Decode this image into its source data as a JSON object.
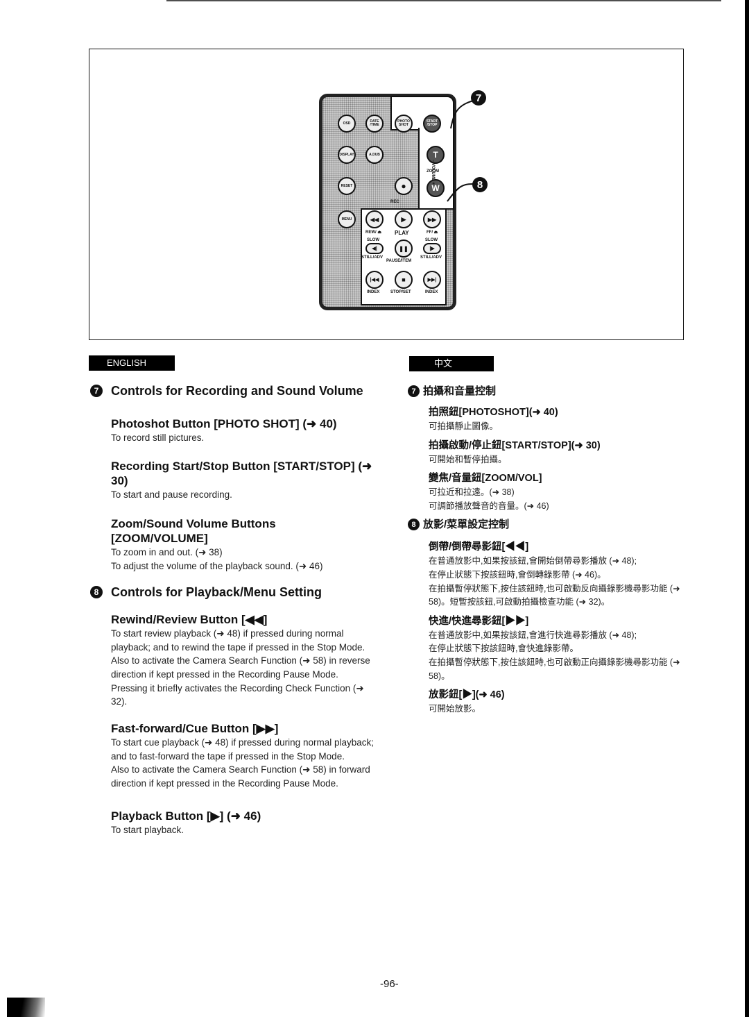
{
  "figure": {
    "remote_buttons": {
      "osd": "OSD",
      "date_time": "DATE /TIME",
      "photo_shot": "PHOTO SHOT",
      "start_stop": "START /STOP",
      "display": "DISPLAY",
      "a_dub": "A.DUB",
      "zoom_t": "T",
      "zoom_label": "ZOOM",
      "zoom_w": "W",
      "volume_label": "– VOLUME +",
      "reset": "RESET",
      "rec": "●",
      "rec_label": "REC",
      "menu": "MENU",
      "rew": "◀◀",
      "rew_label": "REW/ ⏏",
      "play": "▶",
      "play_label": "PLAY",
      "ff": "▶▶",
      "ff_label": "FF/ ⏏",
      "slow_left": "◀|",
      "slow_left_top": "SLOW",
      "slow_left_label": "STILL/ADV",
      "pause": "❚❚",
      "pause_label": "PAUSE/ITEM",
      "slow_right": "|▶",
      "slow_right_top": "SLOW",
      "slow_right_label": "STILL/ADV",
      "index_prev": "|◀◀",
      "index_prev_label": "INDEX",
      "stop": "■",
      "stop_label": "STOP/SET",
      "index_next": "▶▶|",
      "index_next_label": "INDEX"
    },
    "callouts": [
      "7",
      "8"
    ]
  },
  "english": {
    "tab_label": "ENGLISH",
    "sections": [
      {
        "number": "7",
        "title": "Controls for Recording and Sound Volume",
        "items": [
          {
            "title": "Photoshot Button [PHOTO SHOT] (➜ 40)",
            "desc": "To record still pictures."
          },
          {
            "title": "Recording Start/Stop Button [START/STOP] (➜ 30)",
            "desc": "To start and pause recording."
          },
          {
            "title": "Zoom/Sound Volume Buttons [ZOOM/VOLUME]",
            "desc": "To zoom in and out. (➜ 38)\nTo adjust the volume of the playback sound. (➜ 46)"
          }
        ]
      },
      {
        "number": "8",
        "title": "Controls for Playback/Menu Setting",
        "items": [
          {
            "title": "Rewind/Review Button [◀◀]",
            "desc": "To start review playback (➜ 48) if pressed during normal playback; and to rewind the tape if pressed in the Stop Mode.\nAlso to activate the Camera Search Function (➜ 58) in reverse direction if kept pressed in the Recording Pause Mode. Pressing it briefly activates the Recording Check Function (➜ 32)."
          },
          {
            "title": "Fast-forward/Cue Button [▶▶]",
            "desc": "To start cue playback (➜ 48) if pressed during normal playback; and to fast-forward the tape if pressed in the Stop Mode.\nAlso to activate the Camera Search Function (➜ 58) in forward direction if kept pressed in the Recording Pause Mode."
          },
          {
            "title": "Playback Button [▶] (➜ 46)",
            "desc": "To start playback."
          }
        ]
      }
    ]
  },
  "chinese": {
    "tab_label": "中文",
    "sections": [
      {
        "number": "7",
        "title": "拍攝和音量控制",
        "items": [
          {
            "title": "拍照鈕[PHOTOSHOT](➜ 40)",
            "desc": "可拍攝靜止圖像。"
          },
          {
            "title": "拍攝啟動/停止鈕[START/STOP](➜ 30)",
            "desc": "可開始和暫停拍攝。"
          },
          {
            "title": "變焦/音量鈕[ZOOM/VOL]",
            "desc": "可拉近和拉遠。(➜ 38)\n可調節播放聲音的音量。(➜ 46)"
          }
        ]
      },
      {
        "number": "8",
        "title": "放影/菜單設定控制",
        "items": [
          {
            "title": "倒帶/倒帶尋影鈕[◀◀]",
            "desc": "在普通放影中,如果按該鈕,會開始倒帶尋影播放 (➜ 48);\n在停止狀態下按該鈕時,會倒轉錄影帶 (➜ 46)。\n在拍攝暫停狀態下,按住該鈕時,也可啟動反向攝錄影機尋影功能 (➜ 58)。短暫按該鈕,可啟動拍攝檢查功能 (➜ 32)。"
          },
          {
            "title": "快進/快進尋影鈕[▶▶]",
            "desc": "在普通放影中,如果按該鈕,會進行快進尋影播放 (➜ 48);\n在停止狀態下按該鈕時,會快進錄影帶。\n在拍攝暫停狀態下,按住該鈕時,也可啟動正向攝錄影機尋影功能 (➜ 58)。"
          },
          {
            "title": "放影鈕[▶](➜ 46)",
            "desc": "可開始放影。"
          }
        ]
      }
    ]
  },
  "footer": {
    "page_number": "-96-"
  }
}
